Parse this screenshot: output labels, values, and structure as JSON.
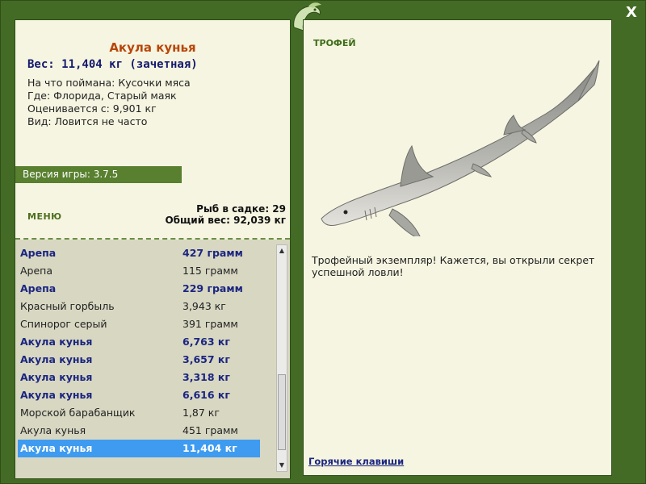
{
  "window": {
    "close_label": "X"
  },
  "fish": {
    "name": "Акула кунья",
    "weight": "Вес: 11,404 кг (зачетная)",
    "caught_on": "На что поймана: Кусочки мяса",
    "location": "Где: Флорида, Старый маяк",
    "value": "Оценивается с: 9,901 кг",
    "rarity": "Вид: Ловится не часто"
  },
  "version": "Версия игры: 3.7.5",
  "menu_label": "МЕНЮ",
  "stats": {
    "keepnet": "Рыб в садке: 29",
    "total_weight": "Общий вес: 92,039 кг"
  },
  "catch_list": [
    {
      "name": "Арепа",
      "weight": "427 грамм",
      "bold": true
    },
    {
      "name": "Арепа",
      "weight": "115 грамм",
      "bold": false
    },
    {
      "name": "Арепа",
      "weight": "229 грамм",
      "bold": true
    },
    {
      "name": "Красный горбыль",
      "weight": "3,943 кг",
      "bold": false
    },
    {
      "name": "Спинорог серый",
      "weight": "391 грамм",
      "bold": false
    },
    {
      "name": "Акула кунья",
      "weight": "6,763 кг",
      "bold": true
    },
    {
      "name": "Акула кунья",
      "weight": "3,657 кг",
      "bold": true
    },
    {
      "name": "Акула кунья",
      "weight": "3,318 кг",
      "bold": true
    },
    {
      "name": "Акула кунья",
      "weight": "6,616 кг",
      "bold": true
    },
    {
      "name": "Морской барабанщик",
      "weight": "1,87 кг",
      "bold": false
    },
    {
      "name": "Акула кунья",
      "weight": "451 грамм",
      "bold": false
    },
    {
      "name": "Акула кунья",
      "weight": "11,404 кг",
      "bold": true,
      "selected": true
    }
  ],
  "trophy_label": "ТРОФЕЙ",
  "message": "Трофейный экземпляр! Кажется, вы открыли секрет успешной ловли!",
  "hotkeys_label": "Горячие клавиши",
  "colors": {
    "frame": "#436b25",
    "panel": "#f6f5e1",
    "selected": "#3e9bf0",
    "accent_text": "#b8460a"
  }
}
